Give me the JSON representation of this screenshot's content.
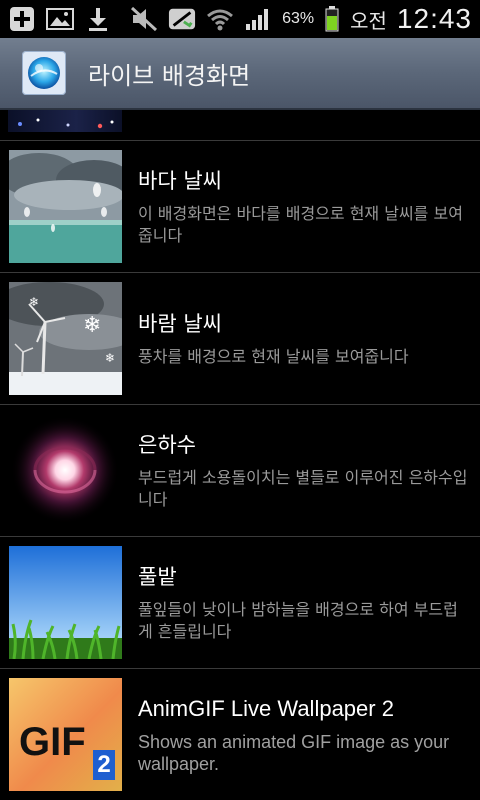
{
  "status_bar": {
    "battery_percent": "63%",
    "ampm": "오전",
    "time": "12:43",
    "icons": [
      "add-icon",
      "image-icon",
      "download-icon",
      "mute-icon",
      "data-sync-off-icon",
      "wifi-icon",
      "signal-icon",
      "battery-icon"
    ]
  },
  "title_bar": {
    "title": "라이브 배경화면",
    "icon": "globe-icon"
  },
  "list": {
    "items": [
      {
        "title": "바다 날씨",
        "description": "이 배경화면은 바다를 배경으로 현재 날씨를 보여줍니다",
        "thumbnail": "sea-weather-thumbnail"
      },
      {
        "title": "바람 날씨",
        "description": "풍차를 배경으로 현재 날씨를 보여줍니다",
        "thumbnail": "wind-weather-thumbnail"
      },
      {
        "title": "은하수",
        "description": "부드럽게 소용돌이치는 별들로 이루어진 은하수입니다",
        "thumbnail": "galaxy-thumbnail"
      },
      {
        "title": "풀밭",
        "description": "풀잎들이 낮이나 밤하늘을 배경으로 하여 부드럽게 흔들립니다",
        "thumbnail": "grass-thumbnail"
      },
      {
        "title": "AnimGIF Live Wallpaper 2",
        "description": "Shows an animated GIF image as your wallpaper.",
        "thumbnail": "gif-thumbnail",
        "thumbnail_text": "GIF",
        "thumbnail_badge": "2"
      }
    ]
  },
  "colors": {
    "background": "#000000",
    "title_bar": "#5b6779",
    "divider": "#3a3a3a",
    "description_text": "#9a9a9a",
    "battery_green": "#7ed321"
  }
}
